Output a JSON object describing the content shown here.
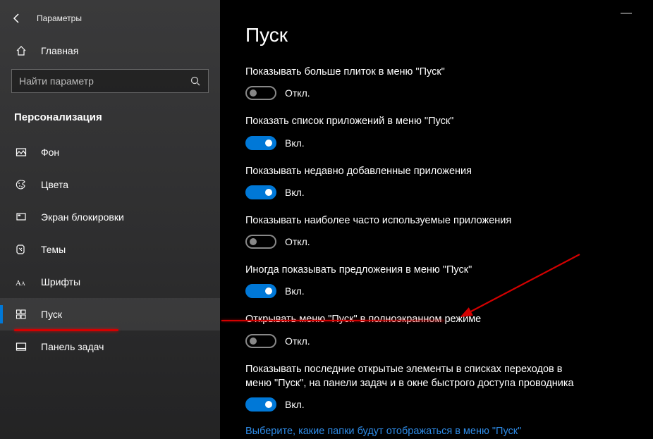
{
  "window": {
    "title": "Параметры"
  },
  "sidebar": {
    "home": "Главная",
    "search_placeholder": "Найти параметр",
    "category": "Персонализация",
    "items": [
      {
        "label": "Фон"
      },
      {
        "label": "Цвета"
      },
      {
        "label": "Экран блокировки"
      },
      {
        "label": "Темы"
      },
      {
        "label": "Шрифты"
      },
      {
        "label": "Пуск"
      },
      {
        "label": "Панель задач"
      }
    ],
    "active_index": 5
  },
  "page": {
    "title": "Пуск",
    "state_on": "Вкл.",
    "state_off": "Откл.",
    "settings": [
      {
        "label": "Показывать больше плиток в меню \"Пуск\"",
        "on": false
      },
      {
        "label": "Показать список приложений в меню \"Пуск\"",
        "on": true
      },
      {
        "label": "Показывать недавно добавленные приложения",
        "on": true
      },
      {
        "label": "Показывать наиболее часто используемые приложения",
        "on": false
      },
      {
        "label": "Иногда показывать предложения в меню \"Пуск\"",
        "on": true
      },
      {
        "label": "Открывать меню \"Пуск\" в полноэкранном режиме",
        "on": false
      },
      {
        "label": "Показывать последние открытые элементы в списках переходов в меню \"Пуск\", на панели задач и в окне быстрого доступа проводника",
        "on": true
      }
    ],
    "link": "Выберите, какие папки будут отображаться в меню \"Пуск\""
  },
  "colors": {
    "accent": "#0078d7",
    "annotation": "#d30000"
  }
}
